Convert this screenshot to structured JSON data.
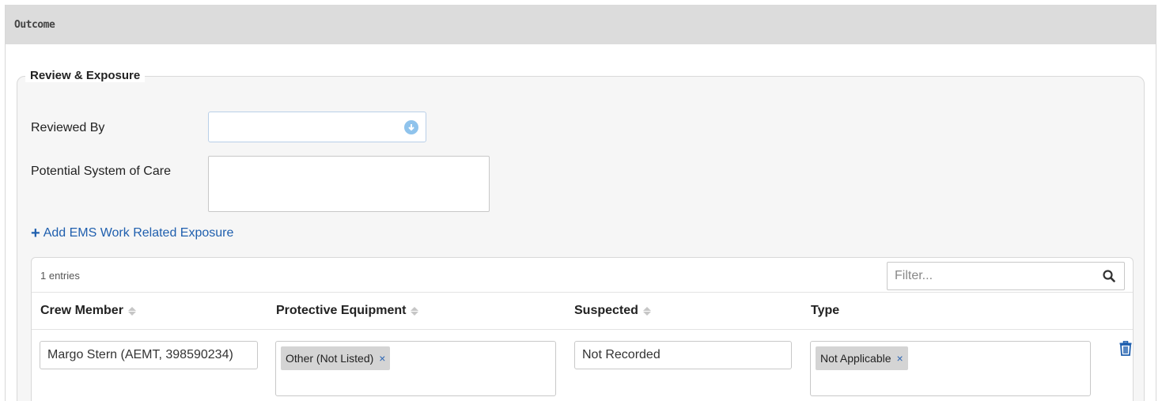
{
  "section": {
    "title": "Outcome"
  },
  "fieldset": {
    "legend": "Review & Exposure",
    "reviewed_by": {
      "label": "Reviewed By",
      "value": ""
    },
    "system_of_care": {
      "label": "Potential System of Care",
      "value": ""
    },
    "add_link": {
      "label": "Add EMS Work Related Exposure"
    }
  },
  "table": {
    "entries": "1 entries",
    "filter_placeholder": "Filter...",
    "columns": [
      "Crew Member",
      "Protective Equipment",
      "Suspected",
      "Type"
    ],
    "rows": [
      {
        "crew_member": "Margo Stern (AEMT, 398590234)",
        "protective_equipment": [
          "Other (Not Listed)"
        ],
        "suspected": "Not Recorded",
        "type": [
          "Not Applicable"
        ]
      }
    ]
  },
  "icons": {
    "select": "chevron-down-circle-icon",
    "search": "search-icon",
    "delete": "trash-icon",
    "add": "plus-icon",
    "remove_tag": "close-icon"
  },
  "colors": {
    "link": "#1f5fae",
    "header_bg": "#dcdcdc",
    "arrow": "#8fc3ec"
  }
}
